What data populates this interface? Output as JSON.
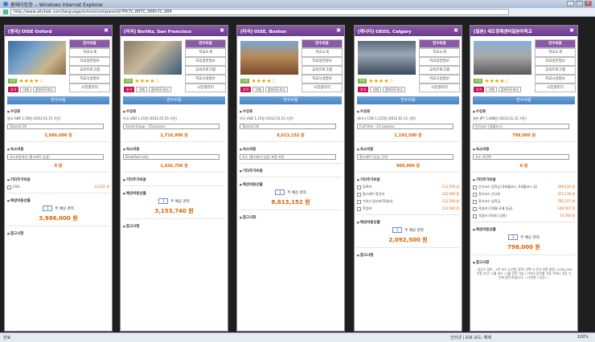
{
  "window": {
    "title": "홈페이징창 -- Windows Internet Explorer",
    "url": "http://www.alluhak.com/language/school/compare/id/?ffh7C,8ff7C,3ff8h7C,9ff4",
    "min": "_",
    "max": "□",
    "close": "×"
  },
  "status": {
    "left": "완료",
    "zone": "인터넷 | 보호 모드: 해제",
    "zoom": "100%"
  },
  "cards": [
    {
      "head": "[영국] OISE Oxford",
      "menu": [
        "연수비용",
        "학교소개",
        "학교일반정보",
        "교육프로그램",
        "학교시설정보",
        "시진갤러리"
      ],
      "badge": "추천",
      "stars": "★★★★☆",
      "acts": [
        "추가",
        "삭제",
        "정보모두보고"
      ],
      "section": "연수비용",
      "s1": "수강료",
      "s1_note": "영국 GBP 1,78원 (2012.01.15 기준)",
      "s1_sel": "Tutorial 16",
      "s1_price": "3,986,000 원",
      "s2": "숙소비용",
      "s2_sel": "숙소포함여부 (홈스테이 싱글)",
      "s2_price": "0 원",
      "s3": "기타추가비용",
      "extras": [
        {
          "name": "CAS",
          "val": "11,631 원"
        }
      ],
      "s4": "예상비용산출",
      "weeks": "1",
      "weeks_lbl": "주 예상 견적",
      "total": "3,986,000 원",
      "s5": "참고사항",
      "note": ""
    },
    {
      "head": "[미국] Berlitz, San Francisco",
      "menu": [
        "연수비용",
        "학교소개",
        "학교일반정보",
        "교육프로그램",
        "학교시설정보",
        "시진갤러리"
      ],
      "badge": "추천",
      "stars": "★★★★☆",
      "acts": [
        "추가",
        "삭제",
        "정보모두보고"
      ],
      "section": "연수비용",
      "s1": "수강료",
      "s1_note": "미국 USD 1,15원 (2012.01.15 기준)",
      "s1_sel": "Small Group - 15Lessons",
      "s1_price": "1,716,990 원",
      "s2": "숙소비용",
      "s2_sel": "Breakfast only",
      "s2_price": "1,436,750 원",
      "s3": "기타추가비용",
      "extras": [],
      "s4": "예상비용산출",
      "weeks": "1",
      "weeks_lbl": "주 예상 견적",
      "total": "3,153,740 원",
      "s5": "참고사항",
      "note": ""
    },
    {
      "head": "[미국] OISE, Boston",
      "menu": [
        "연수비용",
        "학교소개",
        "학교일반정보",
        "교육프로그램",
        "학교시설정보",
        "시진갤러리"
      ],
      "badge": "추천",
      "stars": "★★★★☆",
      "acts": [
        "추가",
        "삭제",
        "정보모두보고"
      ],
      "section": "연수비용",
      "s1": "수강료",
      "s1_note": "미국 USD 1,15원 (2012.01.15 기준)",
      "s1_sel": "Tutorial 16",
      "s1_price": "8,613,152 원",
      "s2": "숙소비용",
      "s2_sel": "숙소 (홈스테이 싱글) 포함 비용",
      "s2_price": "",
      "s3": "기타추가비용",
      "extras": [],
      "s4": "예상비용산출",
      "weeks": "1",
      "weeks_lbl": "주 예상 견적",
      "total": "8,613,152 원",
      "s5": "참고사항",
      "note": ""
    },
    {
      "head": "[캐나다] GEOS, Calgary",
      "menu": [
        "연수비용",
        "학교소개",
        "학교일반정보",
        "교육프로그램",
        "학교시설정보",
        "시진갤러리"
      ],
      "badge": "추천",
      "stars": "★★★★☆",
      "acts": [
        "추가",
        "삭제",
        "정보모두보고"
      ],
      "section": "연수비용",
      "s1": "수강료",
      "s1_note": "캐나다 CAD 1,125원 (2012.01.15 기준)",
      "s1_sel": "Full time - 24 Lessons",
      "s1_price": "1,192,500 원",
      "s2": "숙소비용",
      "s2_sel": "홈스테이 (싱글, 2식)",
      "s2_price": "900,000 원",
      "s3": "기타추가비용",
      "extras": [
        {
          "name": "등록비",
          "val": "112,500 원"
        },
        {
          "name": "홈스테이 알선비",
          "val": "225,000 원"
        },
        {
          "name": "기숙사 알선비(학업비)",
          "val": "112,500 원"
        },
        {
          "name": "학업비",
          "val": "112,500 원"
        }
      ],
      "s4": "예상비용산출",
      "weeks": "1",
      "weeks_lbl": "주 예상 견적",
      "total": "2,092,500 원",
      "s5": "참고사항",
      "note": ""
    },
    {
      "head": "[일본] 세도정제센터일본어학교",
      "menu": [
        "연수비용",
        "학교소개",
        "학교일반정보",
        "교육프로그램",
        "학교시설정보",
        "시진갤러리"
      ],
      "badge": "추천",
      "stars": "★★★★☆",
      "acts": [
        "추가",
        "삭제",
        "정보모두보고"
      ],
      "section": "연수비용",
      "s1": "수강료",
      "s1_note": "일본 JPY 1,498원 (2012.01.15 기준)",
      "s1_sel": "단기코스 (개월코스)",
      "s1_price": "798,000 원",
      "s2": "숙소비용",
      "s2_sel": "숙소 미선택",
      "s2_price": "0 원",
      "s3": "기타추가비용",
      "extras": [
        {
          "name": "단기코스 입학금 (3개월코스, 6개월코스 등)",
          "val": "299,134 원"
        },
        {
          "name": "장기코스 선고료",
          "val": "471,136 원"
        },
        {
          "name": "장기코스 입학금",
          "val": "785,227 원"
        },
        {
          "name": "육업비 (1개월 국제 송금)",
          "val": "149,567 원"
        },
        {
          "name": "육업비 (하네다 공항)",
          "val": "74,784 원"
        }
      ],
      "s4": "예상비용산출",
      "weeks": "1",
      "weeks_lbl": "주 예상 견적",
      "total": "798,000 원",
      "s5": "참고사항",
      "note": "- 입단스 정보 - 1년 코스 (1년반 입학) 선택 시 추가 비용 발생 / ¥162,500 이용 조건 / 2월 코스 / 4월 입학 가능 / 기숙사 입주를 가장 기하니 권장 기간에 입학 바랍니다. ☆(3만원 / 인당) ☆"
    }
  ]
}
